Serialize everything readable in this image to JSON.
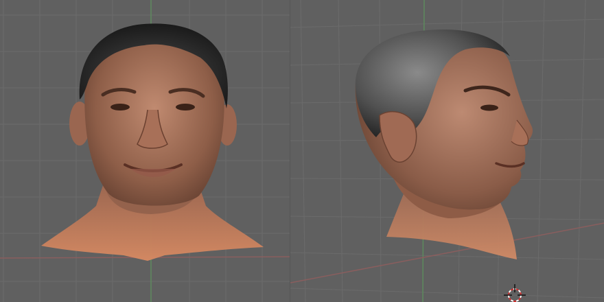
{
  "colors": {
    "background": "#606060",
    "grid_line": "#6a6a6a",
    "axis_x": "#8a5a5a",
    "axis_y": "#5a8a5a",
    "skin": "#b87860",
    "skin_light": "#d89070",
    "hair": "#2a2a2a",
    "cursor_red": "#d03030"
  },
  "viewports": [
    {
      "name": "front-view",
      "projection": "orthographic"
    },
    {
      "name": "perspective-view",
      "projection": "perspective"
    }
  ],
  "model": {
    "type": "head-mesh",
    "texture": "textured"
  },
  "cursor": {
    "icon": "3d-cursor-icon"
  }
}
